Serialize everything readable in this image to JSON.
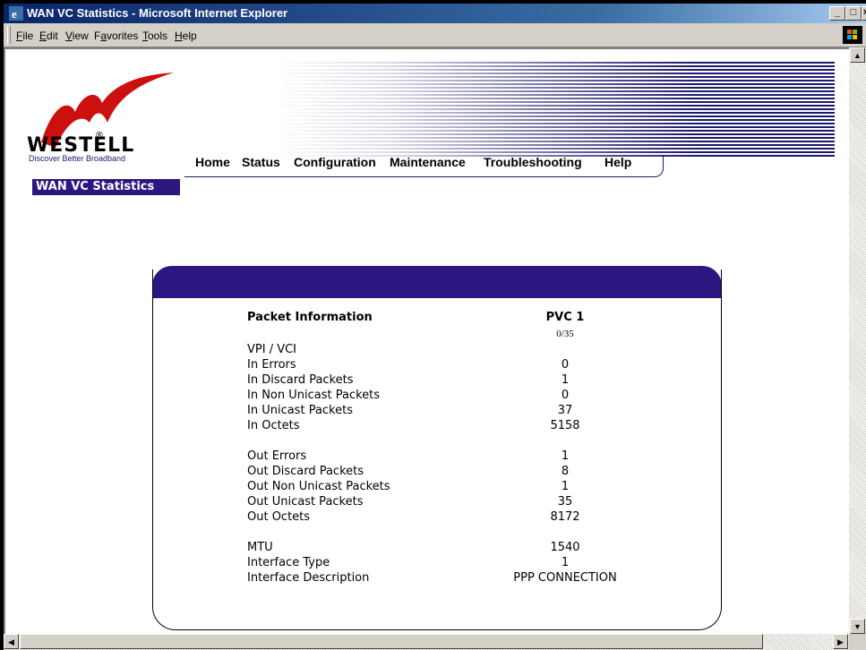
{
  "window": {
    "title": "WAN VC Statistics - Microsoft Internet Explorer"
  },
  "menu": {
    "items": [
      {
        "label": "File",
        "accel": "F"
      },
      {
        "label": "Edit",
        "accel": "E"
      },
      {
        "label": "View",
        "accel": "V"
      },
      {
        "label": "Favorites",
        "accel": "a"
      },
      {
        "label": "Tools",
        "accel": "T"
      },
      {
        "label": "Help",
        "accel": "H"
      }
    ]
  },
  "brand": {
    "name": "WESTELL",
    "tagline": "Discover Better Broadband"
  },
  "nav": {
    "items": [
      "Home",
      "Status",
      "Configuration",
      "Maintenance",
      "Troubleshooting",
      "Help"
    ]
  },
  "page": {
    "tag": "WAN VC Statistics"
  },
  "stats": {
    "header_label": "Packet Information",
    "header_value": "PVC 1",
    "vpi_vci_label": "VPI / VCI",
    "vpi_vci_value": "0/35",
    "rows_in": [
      {
        "label": "In Errors",
        "value": "0"
      },
      {
        "label": "In Discard Packets",
        "value": "1"
      },
      {
        "label": "In Non Unicast Packets",
        "value": "0"
      },
      {
        "label": "In Unicast Packets",
        "value": "37"
      },
      {
        "label": "In Octets",
        "value": "5158"
      }
    ],
    "rows_out": [
      {
        "label": "Out Errors",
        "value": "1"
      },
      {
        "label": "Out Discard Packets",
        "value": "8"
      },
      {
        "label": "Out Non Unicast Packets",
        "value": "1"
      },
      {
        "label": "Out Unicast Packets",
        "value": "35"
      },
      {
        "label": "Out Octets",
        "value": "8172"
      }
    ],
    "rows_misc": [
      {
        "label": "MTU",
        "value": "1540"
      },
      {
        "label": "Interface Type",
        "value": "1"
      },
      {
        "label": "Interface Description",
        "value": "PPP CONNECTION"
      }
    ]
  }
}
